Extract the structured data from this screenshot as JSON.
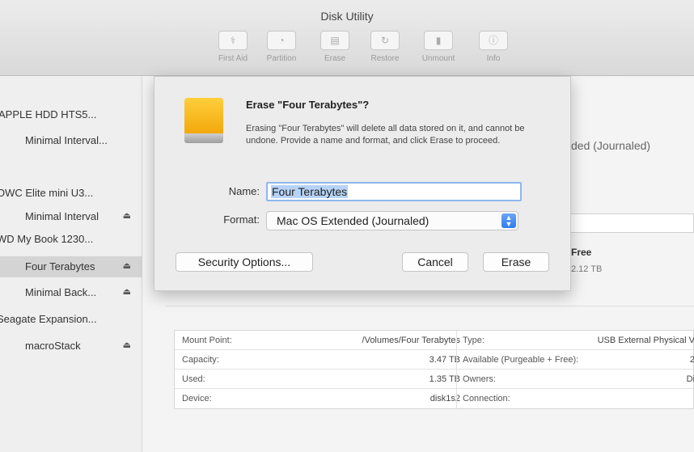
{
  "window": {
    "title": "Disk Utility"
  },
  "toolbar": {
    "items": [
      {
        "label": "First Aid",
        "icon": "stethoscope-icon"
      },
      {
        "label": "Partition",
        "icon": "partition-icon"
      },
      {
        "label": "Erase",
        "icon": "erase-icon"
      },
      {
        "label": "Restore",
        "icon": "restore-icon"
      },
      {
        "label": "Unmount",
        "icon": "unmount-icon"
      },
      {
        "label": "Info",
        "icon": "info-icon"
      }
    ]
  },
  "sidebar": {
    "items": [
      {
        "label": "APPLE HDD HTS5...",
        "eject": false,
        "selected": false
      },
      {
        "label": "Minimal Interval...",
        "eject": false,
        "selected": false
      },
      {
        "label": "OWC Elite mini U3...",
        "eject": false,
        "selected": false
      },
      {
        "label": "Minimal Interval",
        "eject": true,
        "selected": false
      },
      {
        "label": "WD My Book 1230...",
        "eject": false,
        "selected": false
      },
      {
        "label": "Four Terabytes",
        "eject": true,
        "selected": true
      },
      {
        "label": "Minimal Back...",
        "eject": true,
        "selected": false
      },
      {
        "label": "Seagate Expansion...",
        "eject": false,
        "selected": false
      },
      {
        "label": "macroStack",
        "eject": true,
        "selected": false
      }
    ],
    "eject_glyph": "⏏"
  },
  "background": {
    "format_text": "ded (Journaled)",
    "free_label": "Free",
    "free_value": "2.12 TB"
  },
  "info_table": {
    "rows": [
      {
        "k1": "Mount Point:",
        "v1": "/Volumes/Four Terabytes",
        "k2": "Type:",
        "v2": "USB External Physical V"
      },
      {
        "k1": "Capacity:",
        "v1": "3.47 TB",
        "k2": "Available (Purgeable + Free):",
        "v2": "2"
      },
      {
        "k1": "Used:",
        "v1": "1.35 TB",
        "k2": "Owners:",
        "v2": "Di"
      },
      {
        "k1": "Device:",
        "v1": "disk1s2",
        "k2": "Connection:",
        "v2": ""
      }
    ]
  },
  "dialog": {
    "title": "Erase \"Four Terabytes\"?",
    "message": "Erasing \"Four Terabytes\" will delete all data stored on it, and cannot be undone. Provide a name and format, and click Erase to proceed.",
    "name_label": "Name:",
    "name_value": "Four Terabytes",
    "format_label": "Format:",
    "format_value": "Mac OS Extended (Journaled)",
    "security_button": "Security Options...",
    "cancel_button": "Cancel",
    "erase_button": "Erase",
    "icon": "external-drive-icon",
    "accent": "#3a86f2",
    "drive_color": "#f5b321"
  }
}
